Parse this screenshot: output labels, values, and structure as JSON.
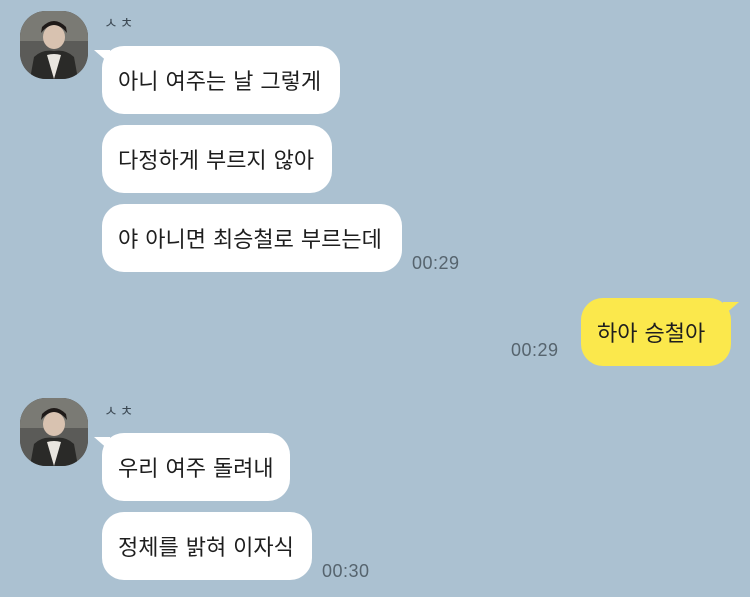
{
  "groups": [
    {
      "sender": "ㅅㅊ",
      "messages": [
        "아니 여주는 날 그렇게",
        "다정하게 부르지 않아",
        "야 아니면 최승철로 부르는데"
      ],
      "time": "00:29"
    },
    {
      "sender": "ㅅㅊ",
      "messages": [
        "우리 여주 돌려내",
        "정체를 밝혀 이자식"
      ],
      "time": "00:30"
    }
  ],
  "outgoing": {
    "message": "하아 승철아",
    "time": "00:29"
  },
  "colors": {
    "background": "#abc1d1",
    "incoming_bubble": "#ffffff",
    "outgoing_bubble": "#fbe84c"
  }
}
